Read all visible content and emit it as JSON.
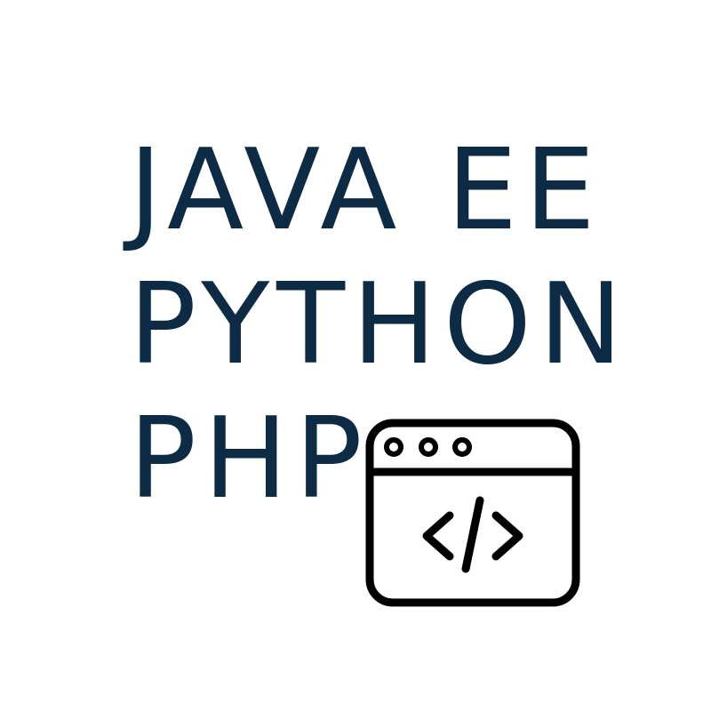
{
  "lines": [
    "JAVA EE",
    "PYTHON",
    "PHP"
  ],
  "icon": "browser-code-icon",
  "colors": {
    "text": "#0d2b45",
    "icon": "#000000",
    "background": "#ffffff"
  }
}
